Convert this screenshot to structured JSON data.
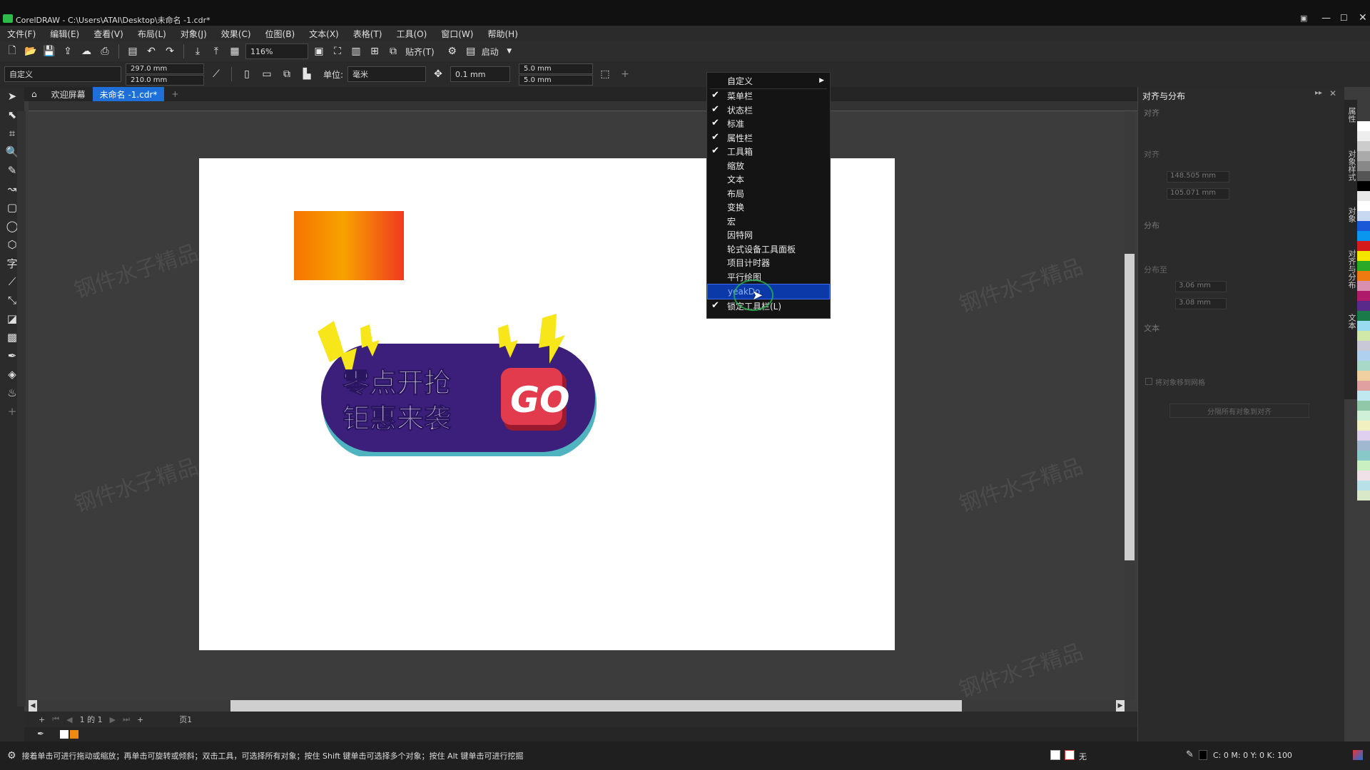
{
  "window": {
    "title": "CorelDRAW - C:\\Users\\ATAI\\Desktop\\未命名 -1.cdr*"
  },
  "menu": [
    "文件(F)",
    "编辑(E)",
    "查看(V)",
    "布局(L)",
    "对象(J)",
    "效果(C)",
    "位图(B)",
    "文本(X)",
    "表格(T)",
    "工具(O)",
    "窗口(W)",
    "帮助(H)"
  ],
  "standard_toolbar": {
    "zoom": "116%",
    "snap_label": "贴齐(T)",
    "launch_label": "启动"
  },
  "property_bar": {
    "preset": "自定义",
    "width": "297.0 mm",
    "height": "210.0 mm",
    "unit_label": "单位:",
    "unit_value": "毫米",
    "nudge": "0.1 mm",
    "dup_x": "5.0 mm",
    "dup_y": "5.0 mm"
  },
  "doc_tabs": {
    "welcome": "欢迎屏幕",
    "current": "未命名 -1.cdr*"
  },
  "context_menu": {
    "header": "自定义",
    "items": [
      {
        "label": "菜单栏",
        "checked": true
      },
      {
        "label": "状态栏",
        "checked": true
      },
      {
        "label": "标准",
        "checked": true
      },
      {
        "label": "属性栏",
        "checked": true
      },
      {
        "label": "工具箱",
        "checked": true
      },
      {
        "label": "缩放",
        "checked": false
      },
      {
        "label": "文本",
        "checked": false
      },
      {
        "label": "布局",
        "checked": false
      },
      {
        "label": "变换",
        "checked": false
      },
      {
        "label": "宏",
        "checked": false
      },
      {
        "label": "因特网",
        "checked": false
      },
      {
        "label": "轮式设备工具面板",
        "checked": false
      },
      {
        "label": "项目计时器",
        "checked": false
      },
      {
        "label": "平行绘图",
        "checked": false
      },
      {
        "label": "yeakDo",
        "checked": false,
        "highlighted": true
      },
      {
        "label": "锁定工具栏(L)",
        "checked": true
      }
    ]
  },
  "artwork": {
    "badge_line1": "零点开抢",
    "badge_line2": "钜惠来袭",
    "badge_go": "GO"
  },
  "dock": {
    "title": "对齐与分布",
    "section_align": "对齐",
    "align_sub": "对齐",
    "pos_x": "148.505 mm",
    "pos_y": "105.071 mm",
    "section_distribute": "分布",
    "distribute_sub": "分布至",
    "spacing_h": "3.06 mm",
    "spacing_v": "3.08 mm",
    "section_text": "文本",
    "checkbox_label": "将对象移到网格",
    "button_label": "分隔所有对象到对齐"
  },
  "dock_vtabs": [
    "属性",
    "对象样式",
    "对象",
    "对齐与分布",
    "文本"
  ],
  "page_nav": {
    "page_count": "1 的 1",
    "page_label": "页1"
  },
  "status": {
    "hint": "接着单击可进行拖动或缩放；再单击可旋转或倾斜；双击工具，可选择所有对象；按住 Shift 键单击可选择多个对象；按住 Alt 键单击可进行挖掘",
    "fill": "无",
    "color_values": "C: 0 M: 0 Y: 0 K: 100"
  },
  "palette_colors": [
    "#ffffff",
    "#eeeeee",
    "#cccccc",
    "#aaaaaa",
    "#888888",
    "#555555",
    "#000000",
    "#e8e8e8",
    "#ffffff",
    "#c8d8f0",
    "#1b58d8",
    "#0a96ee",
    "#d41a1a",
    "#f3e500",
    "#2aa828",
    "#f07a12",
    "#d88fb0",
    "#b01a6a",
    "#5a2a8a",
    "#1a7a4a",
    "#9adaf0",
    "#d0e8a8",
    "#c8c8d8",
    "#b0d0f0",
    "#a8d8c8",
    "#f0d0a0",
    "#e0a0a0",
    "#c0e8f0",
    "#90c8a8",
    "#d0f0d8",
    "#f0f0c0",
    "#e0d0f0",
    "#a0b8d0",
    "#88c8c8",
    "#c8f0c0",
    "#f0e0e8",
    "#b8e0e8",
    "#d8e8c8"
  ],
  "colors": {
    "accent": "#1e6fd8",
    "highlight": "#0b3aa8",
    "badge_purple": "#3b1f7a",
    "go_red": "#e23b4d",
    "bolt": "#f6e61a"
  }
}
